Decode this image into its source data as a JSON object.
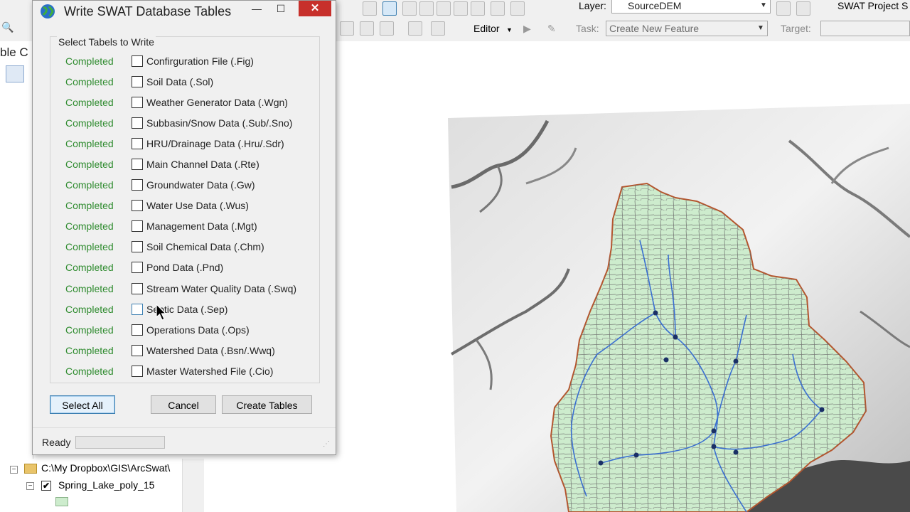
{
  "app": {
    "toolbar": {
      "layer_label": "Layer:",
      "layer_value": "SourceDEM",
      "swat_label": "SWAT Project S",
      "editor_label": "Editor",
      "task_label": "Task:",
      "task_value": "Create New Feature",
      "target_label": "Target:"
    },
    "left_panel": {
      "partial_text": "ble C"
    },
    "toc": {
      "folder_path": "C:\\My Dropbox\\GIS\\ArcSwat\\",
      "layer_name": "Spring_Lake_poly_15",
      "layer_checked": "✔"
    }
  },
  "dialog": {
    "title": "Write SWAT Database Tables",
    "minimize_glyph": "—",
    "maximize_glyph": "☐",
    "close_glyph": "✕",
    "group_label": "Select Tabels to Write",
    "rows": [
      {
        "status": "Completed",
        "label": "Confirguration File (.Fig)"
      },
      {
        "status": "Completed",
        "label": "Soil Data (.Sol)"
      },
      {
        "status": "Completed",
        "label": "Weather Generator Data (.Wgn)"
      },
      {
        "status": "Completed",
        "label": "Subbasin/Snow Data (.Sub/.Sno)"
      },
      {
        "status": "Completed",
        "label": "HRU/Drainage Data (.Hru/.Sdr)"
      },
      {
        "status": "Completed",
        "label": "Main Channel Data (.Rte)"
      },
      {
        "status": "Completed",
        "label": "Groundwater Data (.Gw)"
      },
      {
        "status": "Completed",
        "label": "Water Use Data (.Wus)"
      },
      {
        "status": "Completed",
        "label": "Management Data (.Mgt)"
      },
      {
        "status": "Completed",
        "label": "Soil Chemical Data (.Chm)"
      },
      {
        "status": "Completed",
        "label": "Pond Data (.Pnd)"
      },
      {
        "status": "Completed",
        "label": "Stream Water Quality Data (.Swq)"
      },
      {
        "status": "Completed",
        "label": "Septic Data (.Sep)"
      },
      {
        "status": "Completed",
        "label": "Operations Data (.Ops)"
      },
      {
        "status": "Completed",
        "label": "Watershed Data (.Bsn/.Wwq)"
      },
      {
        "status": "Completed",
        "label": "Master Watershed File (.Cio)"
      }
    ],
    "buttons": {
      "select_all": "Select All",
      "cancel": "Cancel",
      "create_tables": "Create Tables"
    },
    "status": {
      "text": "Ready",
      "progress": 0
    }
  },
  "colors": {
    "completed_text": "#2e8b2e",
    "close_button": "#c7302b",
    "watershed_fill": "#cdeccd",
    "watershed_border": "#b5552d",
    "stream": "#3a6fd0"
  }
}
